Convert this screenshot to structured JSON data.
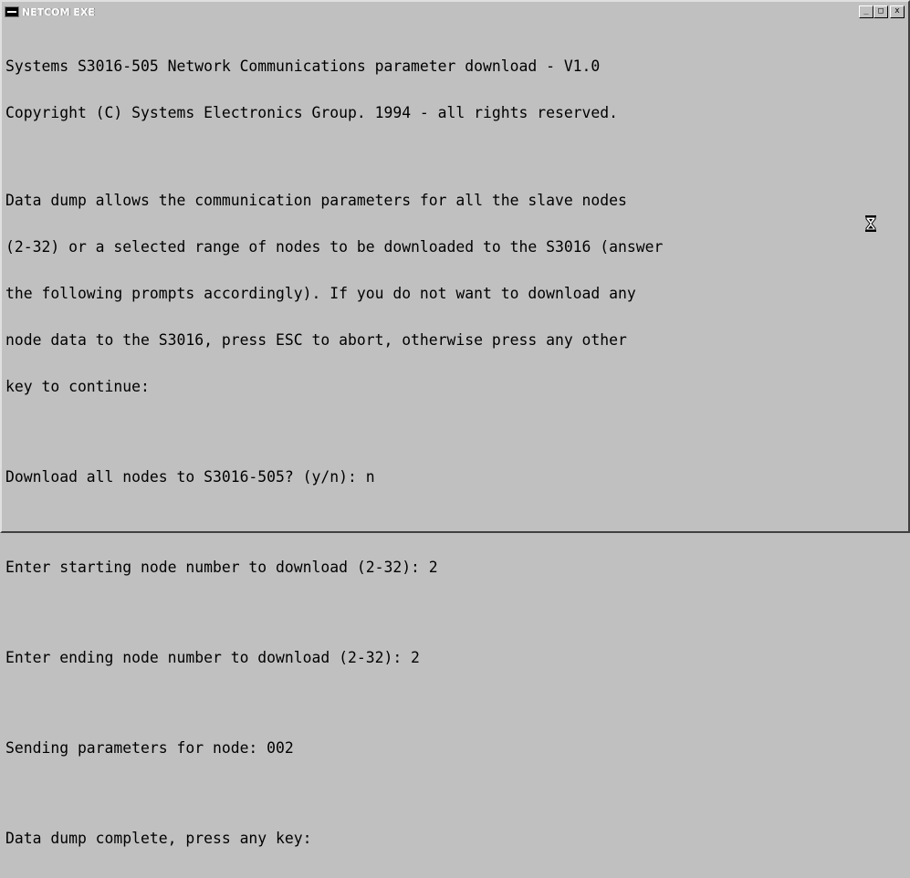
{
  "window": {
    "title": "NETCOM EXE",
    "buttons": {
      "minimize": "_",
      "maximize": "□",
      "close": "x"
    }
  },
  "console": {
    "header": [
      "Systems S3016-505 Network Communications parameter download - V1.0",
      "Copyright (C) Systems Electronics Group. 1994 - all rights reserved."
    ],
    "intro": [
      "Data dump allows the communication parameters for all the slave nodes",
      "(2-32) or a selected range of nodes to be downloaded to the S3016 (answer",
      "the following prompts accordingly). If you do not want to download any",
      "node data to the S3016, press ESC to abort, otherwise press any other",
      "key to continue:"
    ],
    "prompts": [
      "Download all nodes to S3016-505? (y/n): n",
      "Enter starting node number to download (2-32): 2",
      "Enter ending node number to download (2-32): 2",
      "Sending parameters for node: 002",
      "Data dump complete, press any key:"
    ]
  },
  "cursor": {
    "icon": "hourglass-icon"
  }
}
